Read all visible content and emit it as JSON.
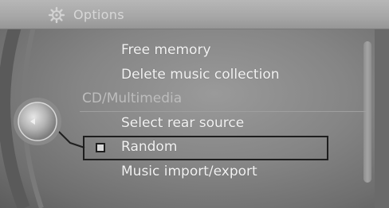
{
  "header": {
    "title": "Options",
    "icon": "settings-gear-icon"
  },
  "menu": {
    "items_top": [
      {
        "label": "Free memory"
      },
      {
        "label": "Delete music collection"
      }
    ],
    "section_label": "CD/Multimedia",
    "items_bottom": [
      {
        "label": "Select rear source"
      },
      {
        "label": "Random",
        "checkbox": true,
        "checked": false,
        "selected": true
      },
      {
        "label": "Music import/export"
      }
    ]
  },
  "controller": {
    "icon": "idrive-controller-knob-icon"
  },
  "colors": {
    "header_text": "#d7d7d7",
    "item_text": "#f2f2f2",
    "section_text": "#bdbdbd",
    "selection_frame": "#1e1e1e"
  }
}
